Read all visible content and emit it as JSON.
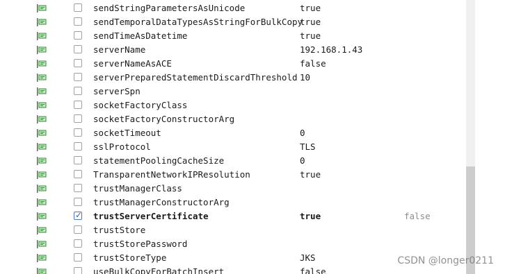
{
  "properties": [
    {
      "name": "sendStringParametersAsUnicode",
      "value": "true",
      "default": "",
      "checked": false,
      "bold": false
    },
    {
      "name": "sendTemporalDataTypesAsStringForBulkCopy",
      "value": "true",
      "default": "",
      "checked": false,
      "bold": false
    },
    {
      "name": "sendTimeAsDatetime",
      "value": "true",
      "default": "",
      "checked": false,
      "bold": false
    },
    {
      "name": "serverName",
      "value": "192.168.1.43",
      "default": "",
      "checked": false,
      "bold": false
    },
    {
      "name": "serverNameAsACE",
      "value": "false",
      "default": "",
      "checked": false,
      "bold": false
    },
    {
      "name": "serverPreparedStatementDiscardThreshold",
      "value": "10",
      "default": "",
      "checked": false,
      "bold": false
    },
    {
      "name": "serverSpn",
      "value": "",
      "default": "",
      "checked": false,
      "bold": false
    },
    {
      "name": "socketFactoryClass",
      "value": "",
      "default": "",
      "checked": false,
      "bold": false
    },
    {
      "name": "socketFactoryConstructorArg",
      "value": "",
      "default": "",
      "checked": false,
      "bold": false
    },
    {
      "name": "socketTimeout",
      "value": "0",
      "default": "",
      "checked": false,
      "bold": false
    },
    {
      "name": "sslProtocol",
      "value": "TLS",
      "default": "",
      "checked": false,
      "bold": false
    },
    {
      "name": "statementPoolingCacheSize",
      "value": "0",
      "default": "",
      "checked": false,
      "bold": false
    },
    {
      "name": "TransparentNetworkIPResolution",
      "value": "true",
      "default": "",
      "checked": false,
      "bold": false
    },
    {
      "name": "trustManagerClass",
      "value": "",
      "default": "",
      "checked": false,
      "bold": false
    },
    {
      "name": "trustManagerConstructorArg",
      "value": "",
      "default": "",
      "checked": false,
      "bold": false
    },
    {
      "name": "trustServerCertificate",
      "value": "true",
      "default": "false",
      "checked": true,
      "bold": true
    },
    {
      "name": "trustStore",
      "value": "",
      "default": "",
      "checked": false,
      "bold": false
    },
    {
      "name": "trustStorePassword",
      "value": "",
      "default": "",
      "checked": false,
      "bold": false
    },
    {
      "name": "trustStoreType",
      "value": "JKS",
      "default": "",
      "checked": false,
      "bold": false
    },
    {
      "name": "useBulkCopyForBatchInsert",
      "value": "false",
      "default": "",
      "checked": false,
      "bold": false
    }
  ],
  "icons": {
    "row_icon": "property-icon",
    "check": "checkmark-icon"
  },
  "colors": {
    "icon_green": "#3a8a3a",
    "check_blue": "#2f62b0"
  },
  "watermark": "CSDN @longer0211"
}
